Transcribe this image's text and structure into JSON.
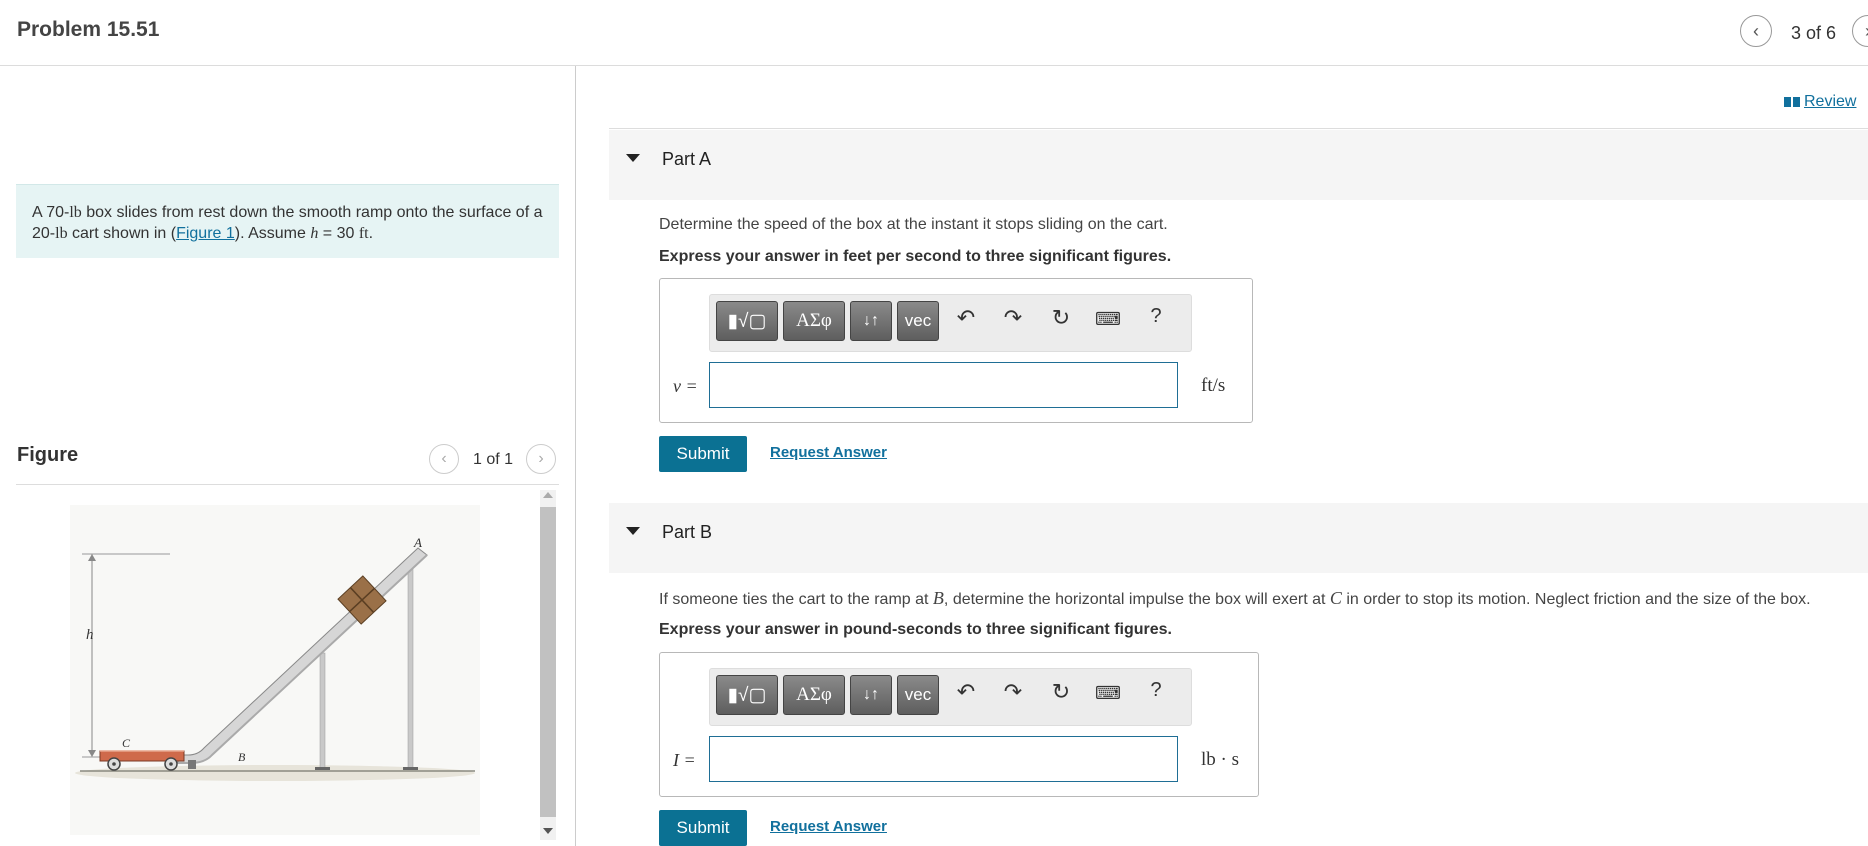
{
  "header": {
    "title": "Problem 15.51",
    "pager": "3 of 6"
  },
  "review_link": "Review",
  "problem": {
    "text_before": "A 70-",
    "unit1": "lb",
    "text_mid1": " box slides from rest down the smooth ramp onto the surface of a 20-",
    "unit2": "lb",
    "text_mid2": " cart shown in (",
    "figure_link": "Figure 1",
    "text_mid3": "). Assume ",
    "var": "h",
    "text_mid4": " = 30 ",
    "unit3": "ft",
    "text_end": "."
  },
  "figure": {
    "label": "Figure",
    "pager": "1 of 1",
    "labels": {
      "A": "A",
      "B": "B",
      "C": "C",
      "h": "h"
    }
  },
  "toolbar": {
    "templates": "▮√▢",
    "greek": "ΑΣφ",
    "arrows": "↓↑",
    "vec": "vec",
    "help": "?"
  },
  "partA": {
    "title": "Part A",
    "question": "Determine the speed of the box at the instant it stops sliding on the cart.",
    "instruction": "Express your answer in feet per second to three significant figures.",
    "var_label": "v =",
    "unit": "ft/s",
    "input_value": "",
    "submit": "Submit",
    "request": "Request Answer"
  },
  "partB": {
    "title": "Part B",
    "q_pre": "If someone ties the cart to the ramp at ",
    "q_var1": "B",
    "q_mid": ", determine the horizontal impulse the box will exert at ",
    "q_var2": "C",
    "q_post": " in order to stop its motion. Neglect friction and the size of the box.",
    "instruction": "Express your answer in pound-seconds to three significant figures.",
    "var_label": "I =",
    "unit": "lb · s",
    "input_value": "",
    "submit": "Submit",
    "request": "Request Answer"
  }
}
